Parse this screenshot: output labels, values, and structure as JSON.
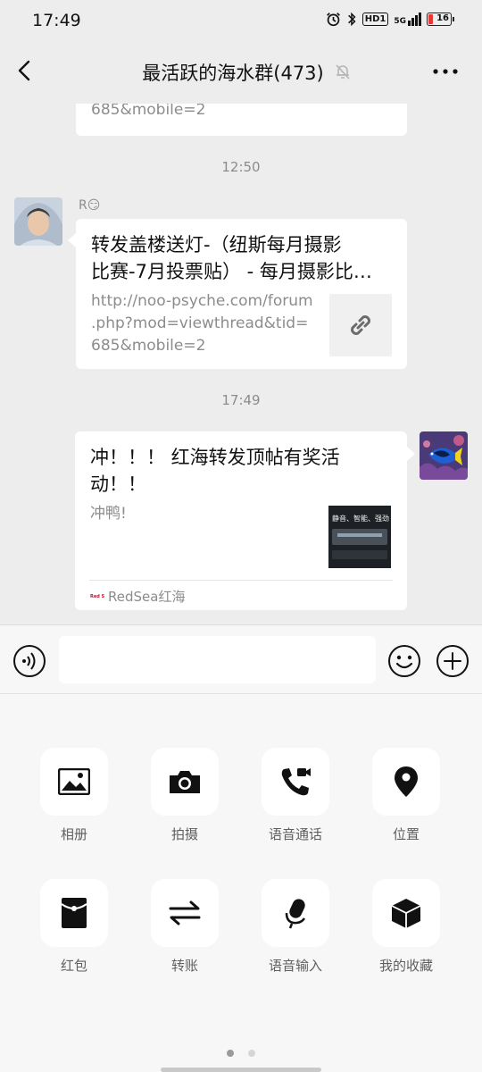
{
  "status_bar": {
    "time": "17:49",
    "hd_label": "HD1",
    "signal_label": "5G",
    "battery": "16",
    "icons": [
      "alarm-icon",
      "bluetooth-icon",
      "hd-icon",
      "signal-icon",
      "battery-icon"
    ]
  },
  "nav": {
    "title": "最活跃的海水群(473)",
    "icons": [
      "back-arrow-icon",
      "mute-bell-icon",
      "more-icon"
    ]
  },
  "chat": {
    "messages": [
      {
        "type": "link",
        "side": "left",
        "desc_partial": "685&mobile=2",
        "icon": "link-icon"
      },
      {
        "type": "timestamp",
        "text": "12:50"
      },
      {
        "type": "link",
        "side": "left",
        "sender": "R😏",
        "avatar": "avatar-hooded-person",
        "title": "转发盖楼送灯-（纽斯每月摄影比赛-7月投票贴）- 每月摄影比…",
        "title_line1": "转发盖楼送灯-（纽斯每月摄影",
        "title_line2": "比赛-7月投票贴） - 每月摄影比…",
        "desc": "http://noo-psyche.com/forum.php?mod=viewthread&tid=685&mobile=2",
        "desc_line1": "http://noo-psyche.com/forum",
        "desc_line2": ".php?mod=viewthread&tid=",
        "desc_line3": "685&mobile=2",
        "icon": "link-icon"
      },
      {
        "type": "timestamp",
        "text": "17:49"
      },
      {
        "type": "article",
        "side": "right",
        "avatar": "avatar-blue-tang-fish",
        "title_line1": "冲！！！ 红海转发顶帖有奖活",
        "title_line2": "动！！",
        "desc": "冲鸭!",
        "thumb_text": "静音、智能、强劲",
        "source_badge": "Red Sea",
        "source": "RedSea红海"
      }
    ]
  },
  "input_bar": {
    "placeholder": "",
    "value": "",
    "icons": [
      "voice-icon",
      "emoji-icon",
      "plus-icon"
    ]
  },
  "panel": {
    "tools": [
      {
        "label": "相册",
        "icon": "photo-album-icon"
      },
      {
        "label": "拍摄",
        "icon": "camera-icon"
      },
      {
        "label": "语音通话",
        "icon": "voice-call-icon"
      },
      {
        "label": "位置",
        "icon": "location-icon"
      },
      {
        "label": "红包",
        "icon": "red-packet-icon"
      },
      {
        "label": "转账",
        "icon": "transfer-icon"
      },
      {
        "label": "语音输入",
        "icon": "microphone-icon"
      },
      {
        "label": "我的收藏",
        "icon": "favorites-icon"
      }
    ],
    "page_count": 2,
    "current_page": 1
  },
  "colors": {
    "background": "#ededed",
    "bubble": "#ffffff",
    "panel": "#f7f7f7",
    "timestamp": "#8c8c8c",
    "icon": "#111111",
    "dot_active": "#9a9a9a",
    "dot_inactive": "#d6d6d6"
  }
}
